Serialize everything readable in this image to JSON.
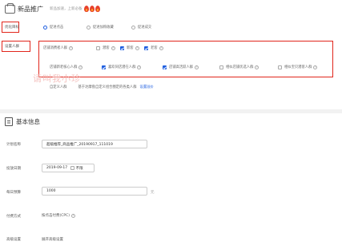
{
  "header": {
    "title": "新品推广",
    "subtitle": "新品加速，上新必备"
  },
  "optimization_goal": {
    "label": "优化目标",
    "options": [
      "促进点击",
      "促进加购收藏",
      "促进成交"
    ]
  },
  "targeting": {
    "label": "设置人群",
    "row1_title": "店铺消费者人群",
    "row1_items": [
      {
        "label": "潜客",
        "checked": false
      },
      {
        "label": "新客",
        "checked": true
      },
      {
        "label": "老客",
        "checked": true
      }
    ],
    "row2_items": [
      {
        "label": "店铺新老核心人群",
        "checked": false
      },
      {
        "label": "喜欢同店潜在人群",
        "checked": true
      },
      {
        "label": "店铺高活跃人群",
        "checked": true
      },
      {
        "label": "相似店铺优选人群",
        "checked": false
      },
      {
        "label": "相似宝贝潜客人群",
        "checked": false
      }
    ],
    "custom_label": "自定义人群",
    "custom_desc": "基于达摩盘自定义组合圈定的各类人群",
    "custom_link": "设置溢价"
  },
  "watermark": "请叫我小珍",
  "basic": {
    "section_title": "基本信息",
    "plan_name_label": "计划名称",
    "plan_name_value": "超级推荐_商品推广_20190917_111019",
    "schedule_label": "投放日期",
    "schedule_value": "2019-09-17",
    "schedule_option": "不限",
    "budget_label": "每日预算",
    "budget_value": "1000",
    "budget_unit": "元",
    "pay_label": "付费方式",
    "pay_value": "按点击付费(CPC)",
    "advanced_label": "高级设置",
    "advanced_link": "展开高级设置"
  },
  "colors": {
    "accent": "#1f5fe0",
    "highlight": "#e1251b"
  }
}
